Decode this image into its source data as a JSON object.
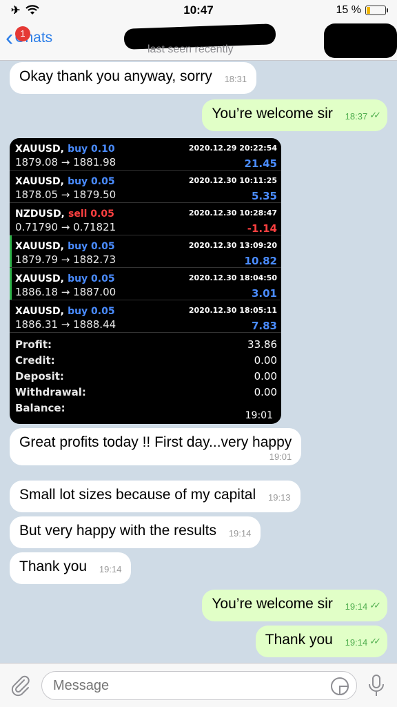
{
  "status_bar": {
    "time": "10:47",
    "battery": "15 %"
  },
  "header": {
    "back_label": "Chats",
    "unread_badge": "1",
    "subtitle": "last seen recently"
  },
  "messages": [
    {
      "dir": "in",
      "text": "Okay thank you anyway, sorry",
      "time": "18:31"
    },
    {
      "dir": "out",
      "text": "You’re welcome sir",
      "time": "18:37"
    },
    {
      "dir": "in",
      "text": "Great profits today !! First day...very happy",
      "time": "19:01"
    },
    {
      "dir": "in",
      "text": "Small lot sizes because of my capital",
      "time": "19:13"
    },
    {
      "dir": "in",
      "text": "But very happy with the results",
      "time": "19:14"
    },
    {
      "dir": "in",
      "text": "Thank you",
      "time": "19:14"
    },
    {
      "dir": "out",
      "text": "You’re welcome sir",
      "time": "19:14"
    },
    {
      "dir": "out",
      "text": "Thank you",
      "time": "19:14"
    }
  ],
  "trade_image": {
    "time": "19:01",
    "trades": [
      {
        "symbol": "XAUUSD,",
        "action": "buy 0.10",
        "side": "buy",
        "date": "2020.12.29 20:22:54",
        "prices": "1879.08 → 1881.98",
        "profit": "21.45",
        "marked": false
      },
      {
        "symbol": "XAUUSD,",
        "action": "buy 0.05",
        "side": "buy",
        "date": "2020.12.30 10:11:25",
        "prices": "1878.05 → 1879.50",
        "profit": "5.35",
        "marked": false
      },
      {
        "symbol": "NZDUSD,",
        "action": "sell 0.05",
        "side": "sell",
        "date": "2020.12.30 10:28:47",
        "prices": "0.71790 → 0.71821",
        "profit": "-1.14",
        "marked": false
      },
      {
        "symbol": "XAUUSD,",
        "action": "buy 0.05",
        "side": "buy",
        "date": "2020.12.30 13:09:20",
        "prices": "1879.79 → 1882.73",
        "profit": "10.82",
        "marked": true
      },
      {
        "symbol": "XAUUSD,",
        "action": "buy 0.05",
        "side": "buy",
        "date": "2020.12.30 18:04:50",
        "prices": "1886.18 → 1887.00",
        "profit": "3.01",
        "marked": true
      },
      {
        "symbol": "XAUUSD,",
        "action": "buy 0.05",
        "side": "buy",
        "date": "2020.12.30 18:05:11",
        "prices": "1886.31 → 1888.44",
        "profit": "7.83",
        "marked": false
      }
    ],
    "summary": [
      {
        "label": "Profit:",
        "value": "33.86"
      },
      {
        "label": "Credit:",
        "value": "0.00"
      },
      {
        "label": "Deposit:",
        "value": "0.00"
      },
      {
        "label": "Withdrawal:",
        "value": "0.00"
      },
      {
        "label": "Balance:",
        "value": ""
      }
    ]
  },
  "input": {
    "placeholder": "Message"
  },
  "colors": {
    "accent": "#2c7ee8",
    "outgoing_bubble": "#e1ffc7",
    "buy": "#4a8cff",
    "sell": "#ff4040"
  }
}
